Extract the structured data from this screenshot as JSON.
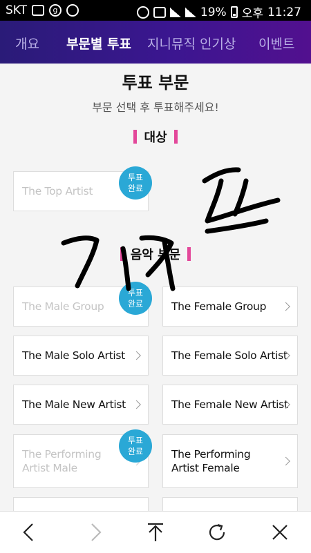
{
  "status": {
    "carrier": "SKT",
    "battery": "19%",
    "ampm": "오후",
    "time": "11:27"
  },
  "nav": {
    "tabs": [
      "개요",
      "부문별 투표",
      "지니뮤직 인기상",
      "이벤트"
    ],
    "active": 1
  },
  "page": {
    "title": "투표 부문",
    "subtitle": "부문 선택 후 투표해주세요!"
  },
  "sections": [
    {
      "title": "대상"
    },
    {
      "title": "음악 부문"
    }
  ],
  "cards": {
    "top_artist": "The Top Artist",
    "male_group": "The Male Group",
    "female_group": "The Female Group",
    "male_solo": "The Male Solo Artist",
    "female_solo": "The Female Solo Artist",
    "male_new": "The Male New Artist",
    "female_new": "The Female New Artist",
    "performing_male_1": "The Performing",
    "performing_male_2": "Artist Male",
    "performing_female_1": "The Performing",
    "performing_female_2": "Artist Female"
  },
  "badge": {
    "line1": "투표",
    "line2": "완료"
  }
}
